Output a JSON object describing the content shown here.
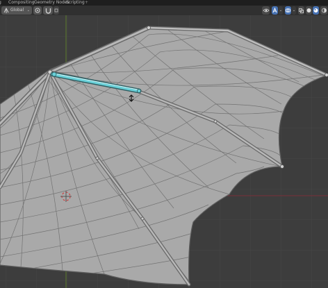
{
  "workspace_tabs": {
    "partial_left": "g",
    "items": [
      "Compositing",
      "Geometry Nodes",
      "Scripting"
    ],
    "add_label": "+"
  },
  "header": {
    "orientation": "Global",
    "pivot_icon": "pivot-point-icon",
    "snap_icon": "snap-magnet-icon",
    "right_icons": [
      "show-gizmo-icon",
      "gizmo-toggle-icon",
      "overlays-icon",
      "xray-toggle-icon",
      "solid-shading-icon",
      "material-preview-icon",
      "rendered-shading-icon"
    ]
  },
  "viewport": {
    "background": "#3d3d3d",
    "grid_color": "#474747",
    "x_axis_color": "#7a2f39",
    "y_axis_color": "#5b7a2b",
    "mesh_fill": "#a9a9a9",
    "wire_color": "#6e6e6e",
    "selected_bone_color": "#69d0d8",
    "object": "bat wing mesh with armature",
    "cursor_icon": "3d-cursor-icon"
  }
}
